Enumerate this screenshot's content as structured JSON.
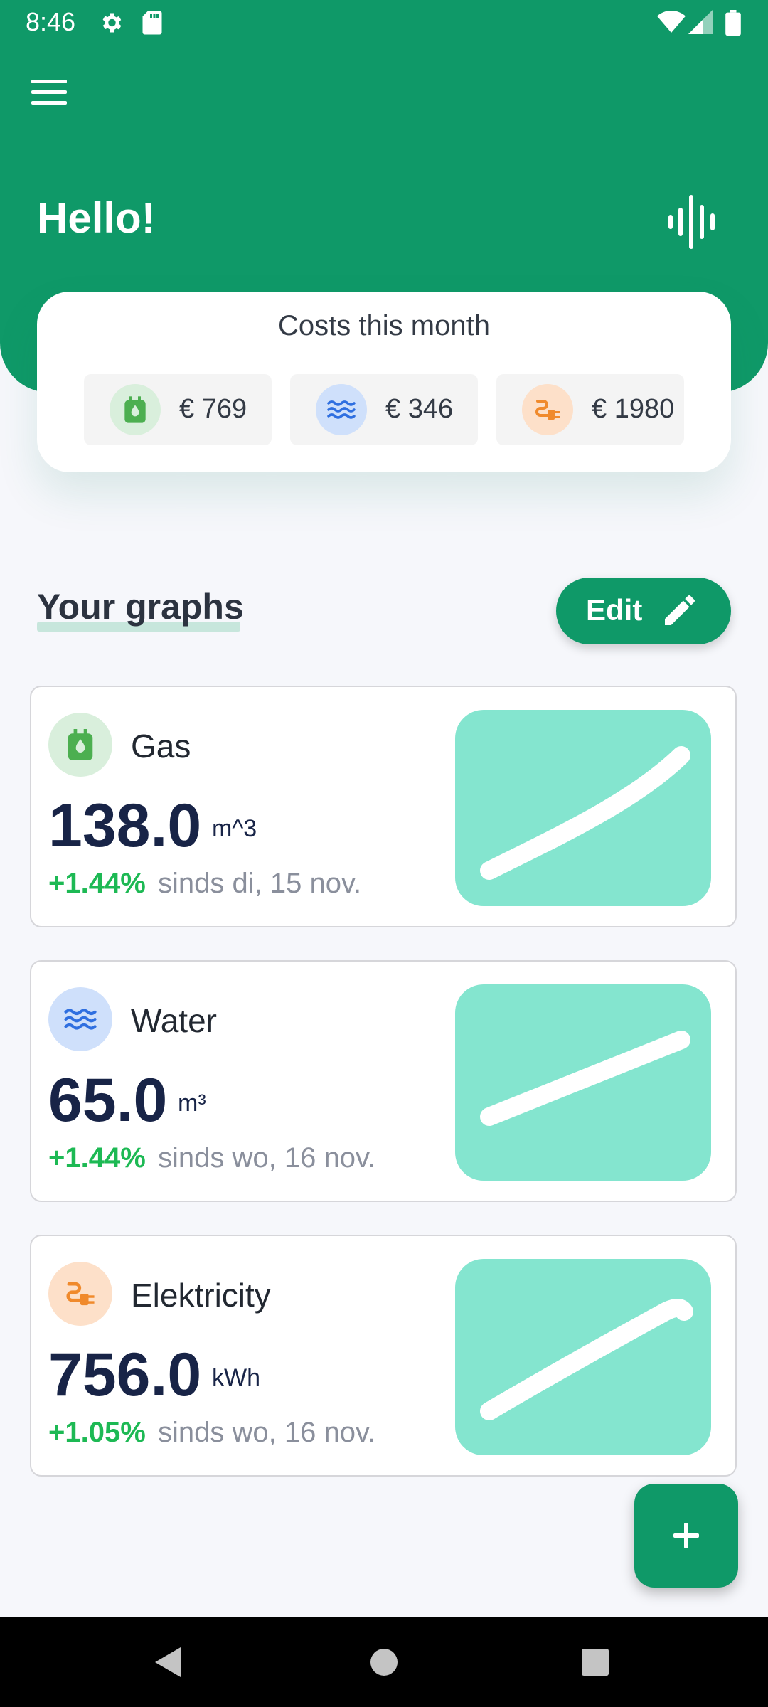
{
  "status_bar": {
    "time": "8:46",
    "left_icons": [
      "gear-icon",
      "sd-card-icon"
    ],
    "right_icons": [
      "wifi-icon",
      "cell-signal-icon",
      "battery-icon"
    ]
  },
  "header": {
    "greeting": "Hello!",
    "menu_icon": "hamburger-menu-icon",
    "voice_icon": "voice-waveform-icon"
  },
  "costs": {
    "title": "Costs this month",
    "items": [
      {
        "type": "gas",
        "icon": "gas-canister-icon",
        "value": "€ 769",
        "icon_color": "#4caf50",
        "icon_bg": "#d9efdc"
      },
      {
        "type": "water",
        "icon": "water-waves-icon",
        "value": "€ 346",
        "icon_color": "#2f6fe0",
        "icon_bg": "#cfe0fb"
      },
      {
        "type": "electricity",
        "icon": "electric-plug-icon",
        "value": "€ 1980",
        "icon_color": "#f08a2c",
        "icon_bg": "#fde0c9"
      }
    ]
  },
  "graphs_section": {
    "title": "Your graphs",
    "edit_label": "Edit",
    "edit_icon": "pencil-icon"
  },
  "graphs": [
    {
      "name": "Gas",
      "value": "138.0",
      "unit": "m^3",
      "change": "+1.44%",
      "since": "sinds di, 15 nov.",
      "icon": "gas-canister-icon"
    },
    {
      "name": "Water",
      "value": "65.0",
      "unit": "m³",
      "change": "+1.44%",
      "since": "sinds wo, 16 nov.",
      "icon": "water-waves-icon"
    },
    {
      "name": "Elektricity",
      "value": "756.0",
      "unit": "kWh",
      "change": "+1.05%",
      "since": "sinds wo, 16 nov.",
      "icon": "electric-plug-icon"
    }
  ],
  "fab": {
    "icon": "plus-icon"
  },
  "nav_bar": {
    "buttons": [
      "back-icon",
      "home-icon",
      "recents-icon"
    ]
  },
  "colors": {
    "primary": "#0f9968",
    "graph_bg": "#84e5cf",
    "positive_change": "#1db954",
    "value_text": "#182447",
    "muted_text": "#8a8f9c"
  }
}
